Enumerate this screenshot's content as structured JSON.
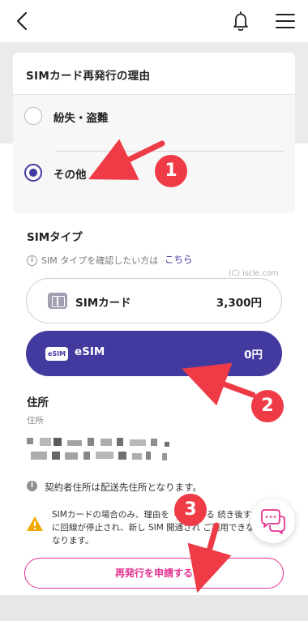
{
  "header": {
    "back": "back-arrow",
    "notifications": "bell-icon",
    "menu": "hamburger-icon"
  },
  "reason": {
    "title": "SIMカード再発行の理由",
    "options": [
      "紛失・盗難",
      "その他"
    ],
    "selected": "その他"
  },
  "sim_type": {
    "title": "SIMタイプ",
    "note": "SIM タイプを確認したい方は",
    "link": "こちら",
    "options": [
      {
        "label": "SIMカード",
        "price": "3,300円",
        "selected": false
      },
      {
        "label": "eSIM",
        "price": "0円",
        "selected": true,
        "badge": "eSIM"
      }
    ]
  },
  "watermark": "(C) iscle.com",
  "address": {
    "title": "住所",
    "sublabel": "住所",
    "notice": "契約者住所は配送先住所となります。"
  },
  "warning": {
    "text": "SIMカードの場合のみ、理由を「 」にする 続き後すぐに回線が停止され、新し SIM 開通され ご利用できなくなります。"
  },
  "submit": {
    "label": "再発行を申請する"
  },
  "annotations": [
    "1",
    "2",
    "3"
  ],
  "colors": {
    "accent": "#433aa0",
    "submit": "#e33390",
    "annotation": "#ee3b45"
  }
}
